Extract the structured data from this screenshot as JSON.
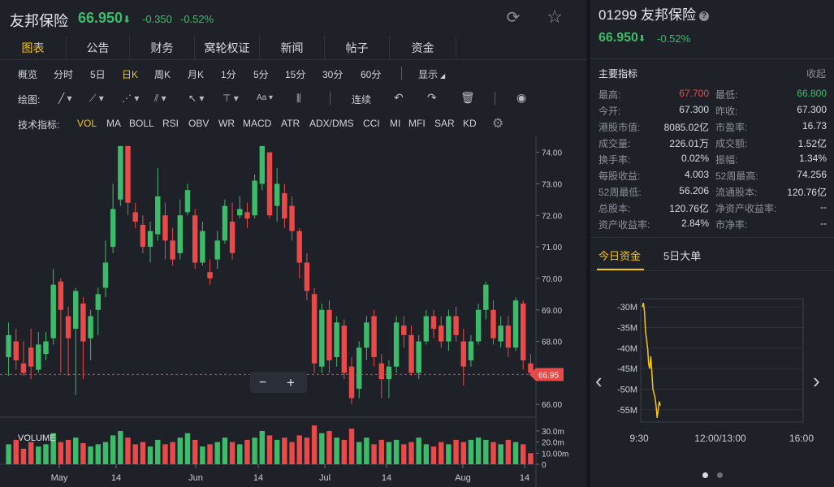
{
  "header": {
    "name": "友邦保险",
    "price": "66.950",
    "arrow": "⬇",
    "change": "-0.350",
    "change_pct": "-0.52%",
    "refresh_icon": "refresh-icon",
    "star_icon": "star-icon"
  },
  "tabs": [
    "图表",
    "公告",
    "财务",
    "窝轮权证",
    "新闻",
    "帖子",
    "资金"
  ],
  "periods": [
    "概览",
    "分时",
    "5日",
    "日K",
    "周K",
    "月K",
    "1分",
    "5分",
    "15分",
    "30分",
    "60分"
  ],
  "period_active": "日K",
  "display_label": "显示",
  "draw_label": "绘图:",
  "draw_tools": [
    "line-tool-icon",
    "polyline-tool-icon",
    "zigzag-tool-icon",
    "channel-tool-icon",
    "arrow-tool-icon",
    "text-tool-icon",
    "font-tool-icon",
    "bars-tool-icon"
  ],
  "aa_label": "Aa",
  "continue_label": "连续",
  "indicators_label": "技术指标:",
  "indicators": [
    "VOL",
    "MA",
    "BOLL",
    "RSI",
    "OBV",
    "WR",
    "MACD",
    "ATR",
    "ADX/DMS",
    "CCI",
    "MI",
    "MFI",
    "SAR",
    "KD"
  ],
  "indicator_active": "VOL",
  "colors": {
    "up": "#e84a4a",
    "down": "#3dbb6a",
    "accent": "#f5c518",
    "bg": "#1e2128"
  },
  "chart_data": {
    "type": "candlestick",
    "y_ticks": [
      "74.00",
      "73.00",
      "72.00",
      "71.00",
      "70.00",
      "69.00",
      "68.00",
      "67.00",
      "66.00"
    ],
    "ylim": [
      65.8,
      74.3
    ],
    "current_price_label": "66.95",
    "x_labels": [
      "May",
      "14",
      "Jun",
      "14",
      "Jul",
      "14",
      "Aug",
      "14"
    ],
    "volume_label": "VOLUME",
    "volume_ticks": [
      "30.0m",
      "20.0m",
      "10.00m",
      "0"
    ],
    "zoom_minus": "−",
    "zoom_plus": "+",
    "candles": [
      {
        "o": 67.5,
        "c": 68.2,
        "h": 68.6,
        "l": 66.9
      },
      {
        "o": 68.0,
        "c": 67.4,
        "h": 68.4,
        "l": 67.1
      },
      {
        "o": 67.3,
        "c": 67.0,
        "h": 68.0,
        "l": 66.9
      },
      {
        "o": 67.8,
        "c": 67.2,
        "h": 68.4,
        "l": 66.8
      },
      {
        "o": 67.1,
        "c": 67.9,
        "h": 68.3,
        "l": 67.0
      },
      {
        "o": 67.6,
        "c": 68.0,
        "h": 68.3,
        "l": 67.4
      },
      {
        "o": 68.1,
        "c": 69.8,
        "h": 70.3,
        "l": 67.9
      },
      {
        "o": 69.9,
        "c": 69.0,
        "h": 70.0,
        "l": 67.0
      },
      {
        "o": 68.8,
        "c": 68.1,
        "h": 69.1,
        "l": 66.9
      },
      {
        "o": 68.4,
        "c": 69.6,
        "h": 69.7,
        "l": 66.3
      },
      {
        "o": 69.2,
        "c": 68.0,
        "h": 69.4,
        "l": 66.8
      },
      {
        "o": 68.1,
        "c": 68.8,
        "h": 69.0,
        "l": 67.4
      },
      {
        "o": 69.0,
        "c": 69.5,
        "h": 69.7,
        "l": 68.2
      },
      {
        "o": 69.7,
        "c": 70.5,
        "h": 71.2,
        "l": 69.4
      },
      {
        "o": 71.0,
        "c": 72.2,
        "h": 73.0,
        "l": 70.8
      },
      {
        "o": 72.5,
        "c": 74.2,
        "h": 74.2,
        "l": 72.3
      },
      {
        "o": 74.2,
        "c": 72.4,
        "h": 74.2,
        "l": 72.0
      },
      {
        "o": 72.1,
        "c": 71.8,
        "h": 72.4,
        "l": 71.6
      },
      {
        "o": 71.7,
        "c": 71.0,
        "h": 72.0,
        "l": 70.8
      },
      {
        "o": 71.0,
        "c": 71.5,
        "h": 71.8,
        "l": 70.5
      },
      {
        "o": 71.4,
        "c": 72.6,
        "h": 73.5,
        "l": 71.2
      },
      {
        "o": 72.0,
        "c": 71.2,
        "h": 72.4,
        "l": 70.6
      },
      {
        "o": 71.2,
        "c": 70.6,
        "h": 71.6,
        "l": 70.4
      },
      {
        "o": 70.8,
        "c": 72.0,
        "h": 72.5,
        "l": 70.6
      },
      {
        "o": 72.1,
        "c": 72.8,
        "h": 73.0,
        "l": 72.0
      },
      {
        "o": 72.0,
        "c": 70.5,
        "h": 72.2,
        "l": 70.3
      },
      {
        "o": 70.5,
        "c": 71.5,
        "h": 71.8,
        "l": 70.4
      },
      {
        "o": 70.2,
        "c": 70.0,
        "h": 70.6,
        "l": 69.8
      },
      {
        "o": 70.6,
        "c": 71.2,
        "h": 71.5,
        "l": 70.3
      },
      {
        "o": 71.2,
        "c": 72.3,
        "h": 72.5,
        "l": 71.1
      },
      {
        "o": 71.8,
        "c": 70.8,
        "h": 72.4,
        "l": 70.6
      },
      {
        "o": 72.0,
        "c": 72.2,
        "h": 72.6,
        "l": 71.9
      },
      {
        "o": 72.1,
        "c": 71.9,
        "h": 72.4,
        "l": 71.6
      },
      {
        "o": 72.0,
        "c": 73.1,
        "h": 73.3,
        "l": 71.9
      },
      {
        "o": 73.0,
        "c": 74.2,
        "h": 74.2,
        "l": 72.8
      },
      {
        "o": 74.0,
        "c": 72.0,
        "h": 74.0,
        "l": 71.9
      },
      {
        "o": 72.3,
        "c": 73.0,
        "h": 73.5,
        "l": 71.8
      },
      {
        "o": 72.7,
        "c": 71.9,
        "h": 73.0,
        "l": 71.6
      },
      {
        "o": 72.3,
        "c": 71.5,
        "h": 72.6,
        "l": 71.2
      },
      {
        "o": 71.5,
        "c": 70.5,
        "h": 71.6,
        "l": 70.0
      },
      {
        "o": 70.5,
        "c": 69.6,
        "h": 70.8,
        "l": 69.3
      },
      {
        "o": 69.5,
        "c": 67.3,
        "h": 69.7,
        "l": 67.0
      },
      {
        "o": 67.2,
        "c": 69.0,
        "h": 69.2,
        "l": 67.0
      },
      {
        "o": 69.0,
        "c": 67.4,
        "h": 69.3,
        "l": 67.0
      },
      {
        "o": 67.5,
        "c": 68.6,
        "h": 68.8,
        "l": 67.2
      },
      {
        "o": 68.5,
        "c": 67.0,
        "h": 68.7,
        "l": 66.8
      },
      {
        "o": 67.2,
        "c": 66.2,
        "h": 67.5,
        "l": 66.0
      },
      {
        "o": 66.5,
        "c": 67.8,
        "h": 68.0,
        "l": 66.2
      },
      {
        "o": 67.8,
        "c": 68.6,
        "h": 68.8,
        "l": 67.4
      },
      {
        "o": 68.8,
        "c": 67.5,
        "h": 69.0,
        "l": 67.2
      },
      {
        "o": 67.3,
        "c": 66.8,
        "h": 67.6,
        "l": 66.2
      },
      {
        "o": 66.8,
        "c": 67.2,
        "h": 67.4,
        "l": 66.2
      },
      {
        "o": 67.2,
        "c": 68.6,
        "h": 68.8,
        "l": 67.0
      },
      {
        "o": 68.5,
        "c": 68.2,
        "h": 68.8,
        "l": 67.8
      },
      {
        "o": 68.2,
        "c": 67.0,
        "h": 68.5,
        "l": 66.9
      },
      {
        "o": 67.0,
        "c": 68.0,
        "h": 68.2,
        "l": 66.8
      },
      {
        "o": 68.0,
        "c": 68.8,
        "h": 69.0,
        "l": 67.9
      },
      {
        "o": 68.8,
        "c": 68.4,
        "h": 69.0,
        "l": 68.1
      },
      {
        "o": 68.5,
        "c": 68.0,
        "h": 68.8,
        "l": 67.8
      },
      {
        "o": 68.0,
        "c": 68.8,
        "h": 69.0,
        "l": 67.7
      },
      {
        "o": 68.8,
        "c": 68.2,
        "h": 69.1,
        "l": 68.0
      },
      {
        "o": 68.0,
        "c": 67.2,
        "h": 68.4,
        "l": 66.6
      },
      {
        "o": 67.4,
        "c": 68.0,
        "h": 68.2,
        "l": 67.2
      },
      {
        "o": 68.0,
        "c": 69.0,
        "h": 69.2,
        "l": 67.9
      },
      {
        "o": 69.0,
        "c": 69.8,
        "h": 69.9,
        "l": 68.7
      },
      {
        "o": 69.0,
        "c": 68.1,
        "h": 69.3,
        "l": 67.9
      },
      {
        "o": 68.0,
        "c": 68.5,
        "h": 68.8,
        "l": 67.8
      },
      {
        "o": 68.5,
        "c": 67.8,
        "h": 68.8,
        "l": 67.5
      },
      {
        "o": 67.8,
        "c": 69.3,
        "h": 69.4,
        "l": 67.7
      },
      {
        "o": 69.2,
        "c": 67.4,
        "h": 69.3,
        "l": 67.1
      },
      {
        "o": 67.3,
        "c": 67.0,
        "h": 67.6,
        "l": 66.9
      }
    ],
    "volumes": [
      18,
      22,
      14,
      20,
      16,
      18,
      28,
      20,
      22,
      24,
      19,
      16,
      18,
      20,
      26,
      30,
      24,
      18,
      20,
      16,
      22,
      18,
      20,
      24,
      28,
      22,
      16,
      18,
      20,
      24,
      20,
      18,
      22,
      24,
      30,
      26,
      22,
      24,
      20,
      26,
      24,
      35,
      28,
      30,
      24,
      22,
      32,
      20,
      24,
      18,
      22,
      20,
      22,
      18,
      20,
      24,
      18,
      16,
      20,
      18,
      22,
      20,
      22,
      24,
      22,
      20,
      18,
      22,
      20,
      18,
      10
    ]
  },
  "right_panel": {
    "title": "01299 友邦保险",
    "price": "66.950",
    "arrow": "⬇",
    "change_pct": "-0.52%",
    "indicators_title": "主要指标",
    "collapse_label": "收起",
    "metrics": [
      [
        "最高:",
        "67.700",
        "最低:",
        "66.800"
      ],
      [
        "今开:",
        "67.300",
        "昨收:",
        "67.300"
      ],
      [
        "港股市值:",
        "8085.02亿",
        "市盈率:",
        "16.73"
      ],
      [
        "成交量:",
        "226.01万",
        "成交额:",
        "1.52亿"
      ],
      [
        "换手率:",
        "0.02%",
        "振幅:",
        "1.34%"
      ],
      [
        "每股收益:",
        "4.003",
        "52周最高:",
        "74.256"
      ],
      [
        "52周最低:",
        "56.206",
        "流通股本:",
        "120.76亿"
      ],
      [
        "总股本:",
        "120.76亿",
        "净资产收益率:",
        "--"
      ],
      [
        "资产收益率:",
        "2.84%",
        "市净率:",
        "--"
      ]
    ],
    "flow_tabs": [
      "今日资金",
      "5日大单"
    ],
    "flow_chart": {
      "type": "line",
      "y_ticks": [
        "-30M",
        "-35M",
        "-40M",
        "-45M",
        "-50M",
        "-55M"
      ],
      "x_ticks": [
        "9:30",
        "12:00/13:00",
        "16:00"
      ],
      "values": [
        -30,
        -29,
        -31,
        -36,
        -38,
        -40,
        -44,
        -45,
        -42,
        -46,
        -50,
        -51,
        -52,
        -54,
        -57,
        -55,
        -53,
        -54
      ]
    },
    "dots": 2
  }
}
